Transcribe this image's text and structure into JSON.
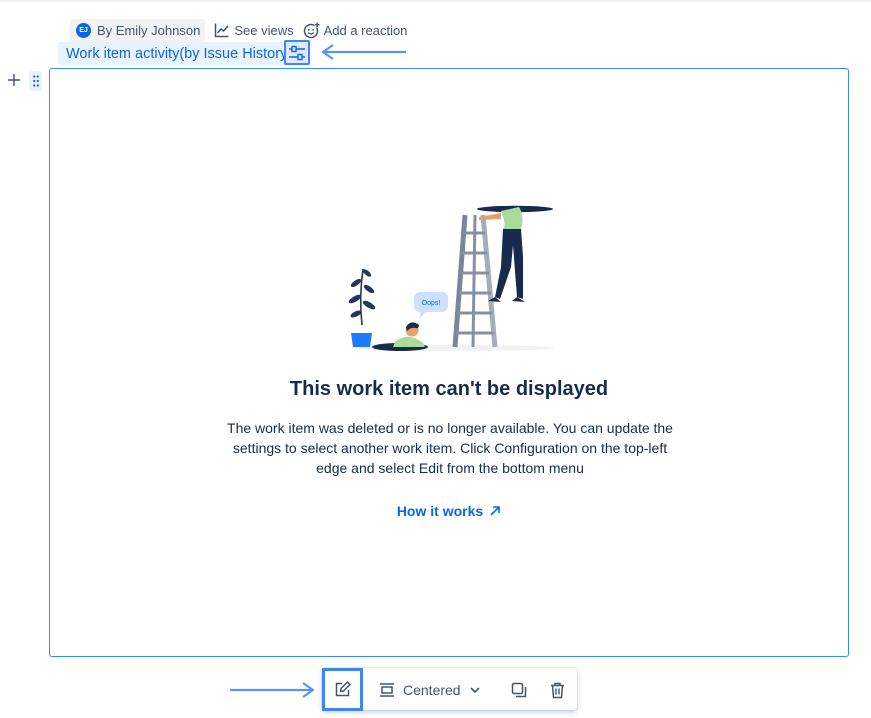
{
  "byline": {
    "author_initials": "EJ",
    "author": "By Emily Johnson",
    "see_views": "See views",
    "add_reaction": "Add a reaction"
  },
  "macro": {
    "title": "Work item activity(by Issue History",
    "config_icon": "sliders-icon"
  },
  "empty_state": {
    "illustration_bubble": "Oops!",
    "title": "This work item can't be displayed",
    "description": "The work item was deleted or is no longer available. You can update the settings to select another work item. Click Configuration on the top-left edge and select Edit from the bottom menu",
    "link": "How it works"
  },
  "toolbar": {
    "edit_icon": "edit-icon",
    "layout_label": "Centered",
    "layout_icon": "align-center-icon",
    "copy_icon": "copy-icon",
    "delete_icon": "trash-icon"
  },
  "colors": {
    "accent": "#0c66e4",
    "highlight_border": "#3d86f5",
    "macro_border": "#388bff",
    "title_background": "#e9f2ff"
  }
}
